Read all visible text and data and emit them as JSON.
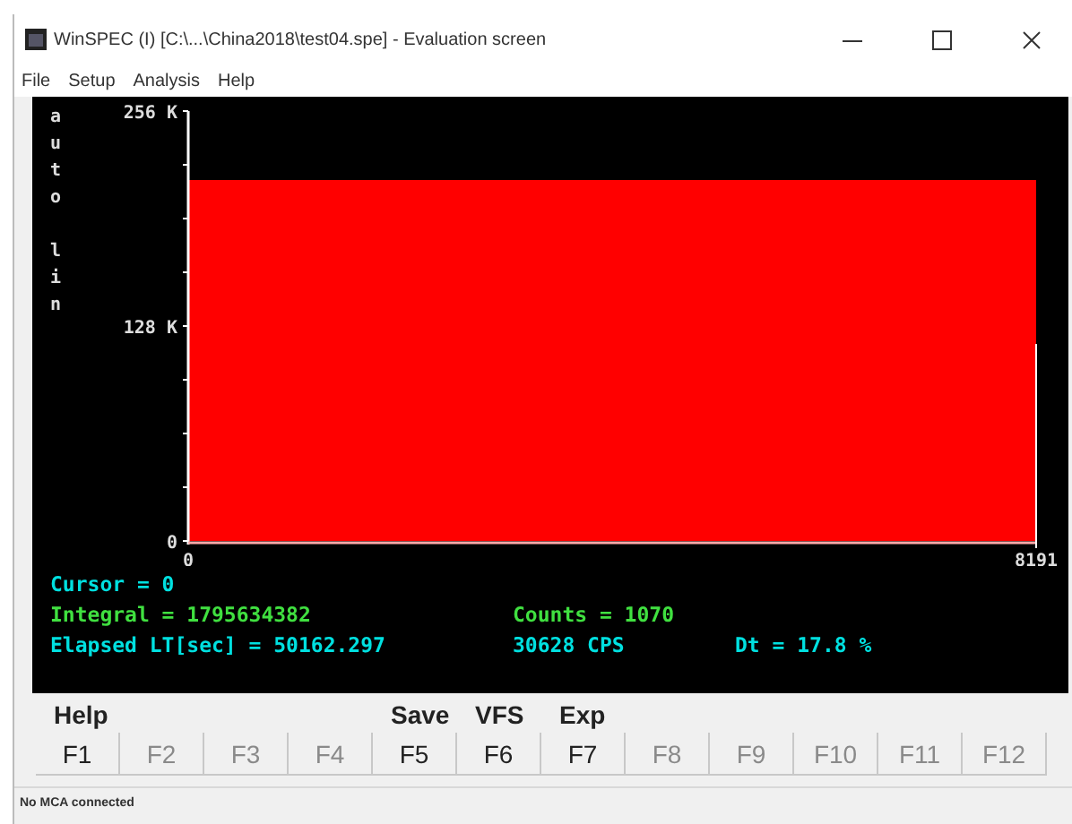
{
  "window": {
    "title": "WinSPEC (I) [C:\\...\\China2018\\test04.spe] - Evaluation screen"
  },
  "menu": [
    {
      "label": "File"
    },
    {
      "label": "Setup"
    },
    {
      "label": "Analysis"
    },
    {
      "label": "Help"
    }
  ],
  "spectrum": {
    "chart_data": {
      "type": "area",
      "ylabel": "auto lin",
      "x": [
        0,
        8191
      ],
      "series": [
        {
          "color": "#ff0000",
          "values": [
            215000,
            215000
          ]
        }
      ],
      "xlim": [
        0,
        8191
      ],
      "ylim": [
        0,
        256000
      ],
      "xticks": [
        0,
        8191
      ],
      "yticks": [
        {
          "value": 0,
          "label": "0"
        },
        {
          "value": 128000,
          "label": "128 K"
        },
        {
          "value": 256000,
          "label": "256 K"
        }
      ]
    }
  },
  "readouts": [
    [
      {
        "text": "Cursor = 0",
        "color": "#00e0e0"
      }
    ],
    [
      {
        "text": "Integral = 1795634382",
        "color": "#40e040"
      },
      {
        "text": "Counts = 1070",
        "color": "#40e040"
      }
    ],
    [
      {
        "text": "Elapsed LT[sec] = 50162.297",
        "color": "#00e0e0"
      },
      {
        "text": "30628 CPS",
        "color": "#00e0e0"
      },
      {
        "text": "Dt = 17.8 %",
        "color": "#00e0e0"
      }
    ]
  ],
  "function_keys": [
    {
      "key": "F1",
      "label": "Help",
      "disabled": false
    },
    {
      "key": "F2",
      "disabled": true
    },
    {
      "key": "F3",
      "disabled": true
    },
    {
      "key": "F4",
      "disabled": true
    },
    {
      "key": "F5",
      "label": "Save",
      "disabled": false
    },
    {
      "key": "F6",
      "label": "VFS",
      "disabled": false
    },
    {
      "key": "F7",
      "label": "Exp",
      "disabled": false
    },
    {
      "key": "F8",
      "disabled": true
    },
    {
      "key": "F9",
      "disabled": true
    },
    {
      "key": "F10",
      "disabled": true
    },
    {
      "key": "F11",
      "disabled": true
    },
    {
      "key": "F12",
      "disabled": true
    }
  ],
  "status_bar": {
    "text": "No MCA connected"
  }
}
